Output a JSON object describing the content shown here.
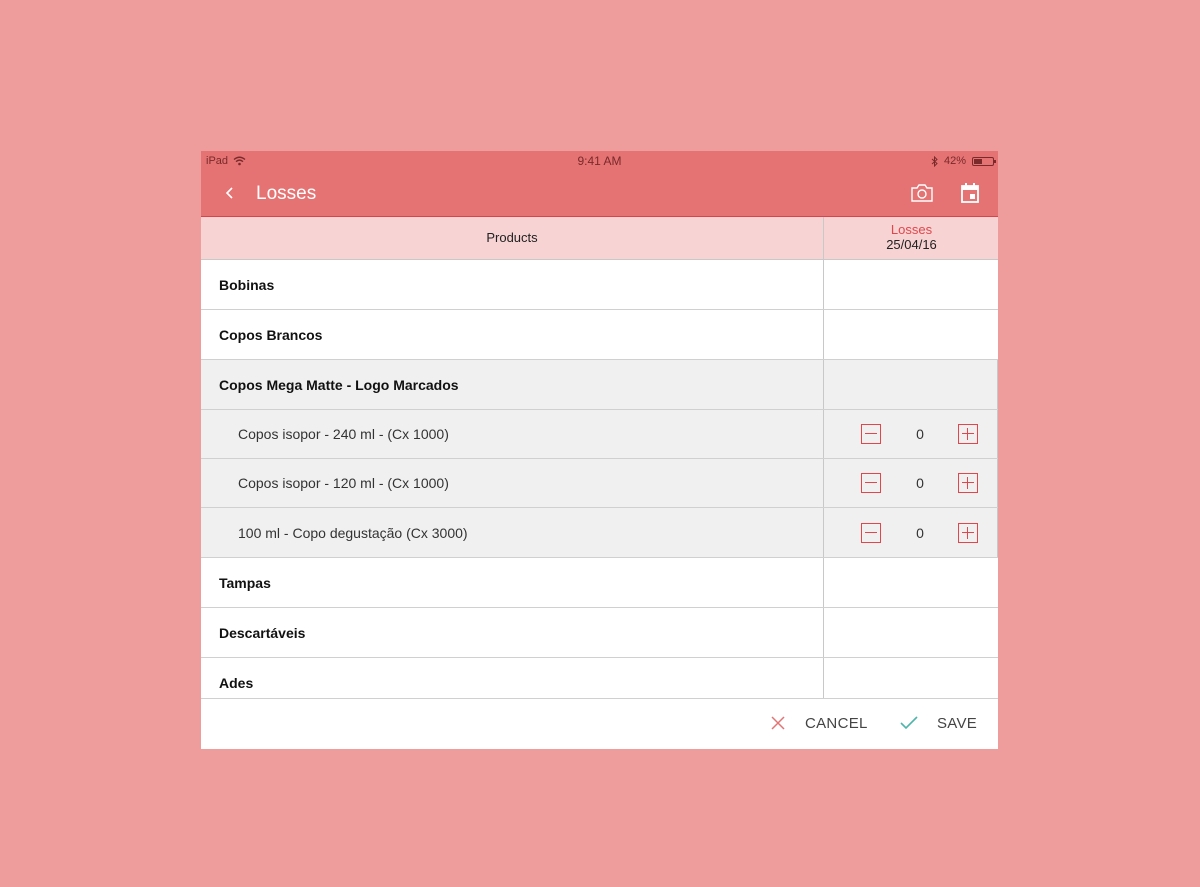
{
  "status_bar": {
    "device": "iPad",
    "time": "9:41 AM",
    "battery_percent": "42%",
    "battery_level": 0.42
  },
  "nav": {
    "title": "Losses"
  },
  "table_header": {
    "products_label": "Products",
    "losses_label": "Losses",
    "losses_date": "25/04/16"
  },
  "rows": [
    {
      "name": "Bobinas",
      "type": "category"
    },
    {
      "name": "Copos Brancos",
      "type": "category"
    },
    {
      "name": "Copos Mega Matte - Logo Marcados",
      "type": "category",
      "expanded": true
    },
    {
      "name": "Copos isopor - 240 ml - (Cx 1000)",
      "type": "product",
      "value": "0"
    },
    {
      "name": "Copos isopor - 120 ml - (Cx 1000)",
      "type": "product",
      "value": "0"
    },
    {
      "name": "100 ml - Copo degustação (Cx 3000)",
      "type": "product",
      "value": "0"
    },
    {
      "name": "Tampas",
      "type": "category"
    },
    {
      "name": "Descartáveis",
      "type": "category"
    },
    {
      "name": "Ades",
      "type": "category"
    }
  ],
  "footer": {
    "cancel_label": "CANCEL",
    "save_label": "SAVE"
  },
  "colors": {
    "background": "#ef9c9c",
    "header": "#e57373",
    "accent": "#e0474c",
    "save_check": "#4db6ac",
    "cancel_x": "#e57373"
  }
}
